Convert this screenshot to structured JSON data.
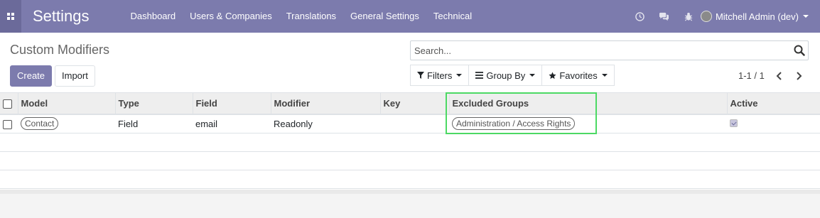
{
  "navbar": {
    "brand": "Settings",
    "menu": [
      "Dashboard",
      "Users & Companies",
      "Translations",
      "General Settings",
      "Technical"
    ],
    "user": "Mitchell Admin (dev)",
    "icons": [
      "clock-icon",
      "chat-icon",
      "bug-icon"
    ]
  },
  "control": {
    "title": "Custom Modifiers",
    "create_label": "Create",
    "import_label": "Import",
    "search_placeholder": "Search...",
    "filters_label": "Filters",
    "groupby_label": "Group By",
    "favorites_label": "Favorites",
    "pager": "1-1 / 1"
  },
  "table": {
    "columns": [
      "Model",
      "Type",
      "Field",
      "Modifier",
      "Key",
      "Excluded Groups",
      "Active"
    ],
    "rows": [
      {
        "model": "Contact",
        "type": "Field",
        "field": "email",
        "modifier": "Readonly",
        "key": "",
        "excluded_groups": "Administration / Access Rights",
        "active": true
      }
    ]
  },
  "colors": {
    "brand": "#7c7bad",
    "highlight": "#4cd964"
  }
}
